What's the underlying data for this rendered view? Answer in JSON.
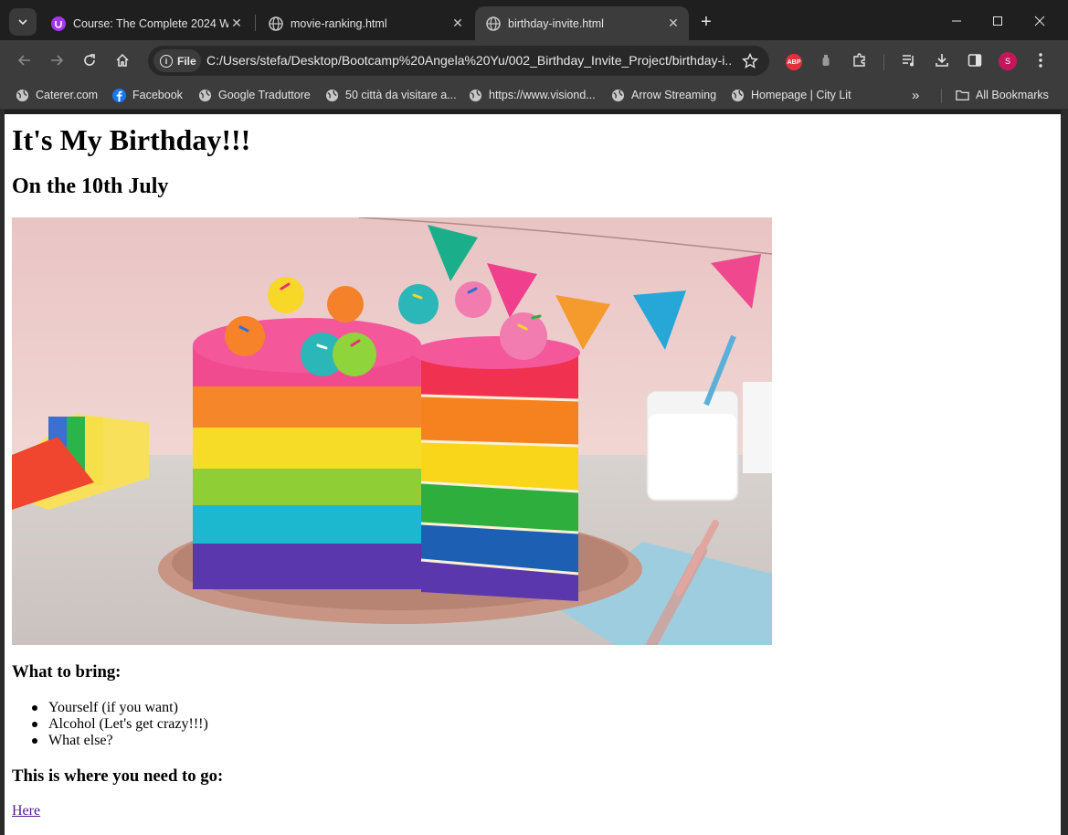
{
  "browser": {
    "tabs": [
      {
        "label": "Course: The Complete 2024 We",
        "favicon": "udemy-icon",
        "active": false
      },
      {
        "label": "movie-ranking.html",
        "favicon": "globe-icon",
        "active": false
      },
      {
        "label": "birthday-invite.html",
        "favicon": "globe-icon",
        "active": true
      }
    ],
    "omnibox": {
      "chip_label": "File",
      "url": "C:/Users/stefa/Desktop/Bootcamp%20Angela%20Yu/002_Birthday_Invite_Project/birthday-i..."
    },
    "extensions": {
      "adblock_label": "ABP",
      "profile_initial": "S"
    },
    "bookmarks": [
      {
        "label": "Caterer.com",
        "icon": "globe-icon"
      },
      {
        "label": "Facebook",
        "icon": "facebook-icon"
      },
      {
        "label": "Google Traduttore",
        "icon": "globe-icon"
      },
      {
        "label": "50 città da visitare a...",
        "icon": "globe-icon"
      },
      {
        "label": "https://www.visiond...",
        "icon": "globe-icon"
      },
      {
        "label": "Arrow Streaming",
        "icon": "globe-icon"
      },
      {
        "label": "Homepage | City Lit",
        "icon": "globe-icon"
      }
    ],
    "bookmarks_more": "»",
    "all_bookmarks_label": "All Bookmarks",
    "colors": {
      "tabstrip": "#1f1f1f",
      "toolbar": "#3c3c3c",
      "omnibox": "#282828",
      "link_visited": "#551a8b"
    }
  },
  "page": {
    "title": "It's My Birthday!!!",
    "date": "On the 10th July",
    "image_subject": "rainbow-layer-cake",
    "bring_heading": "What to bring:",
    "bring_items": [
      "Yourself (if you want)",
      "Alcohol (Let's get crazy!!!)",
      "What else?"
    ],
    "directions_heading": "This is where you need to go:",
    "directions_link": "Here"
  }
}
